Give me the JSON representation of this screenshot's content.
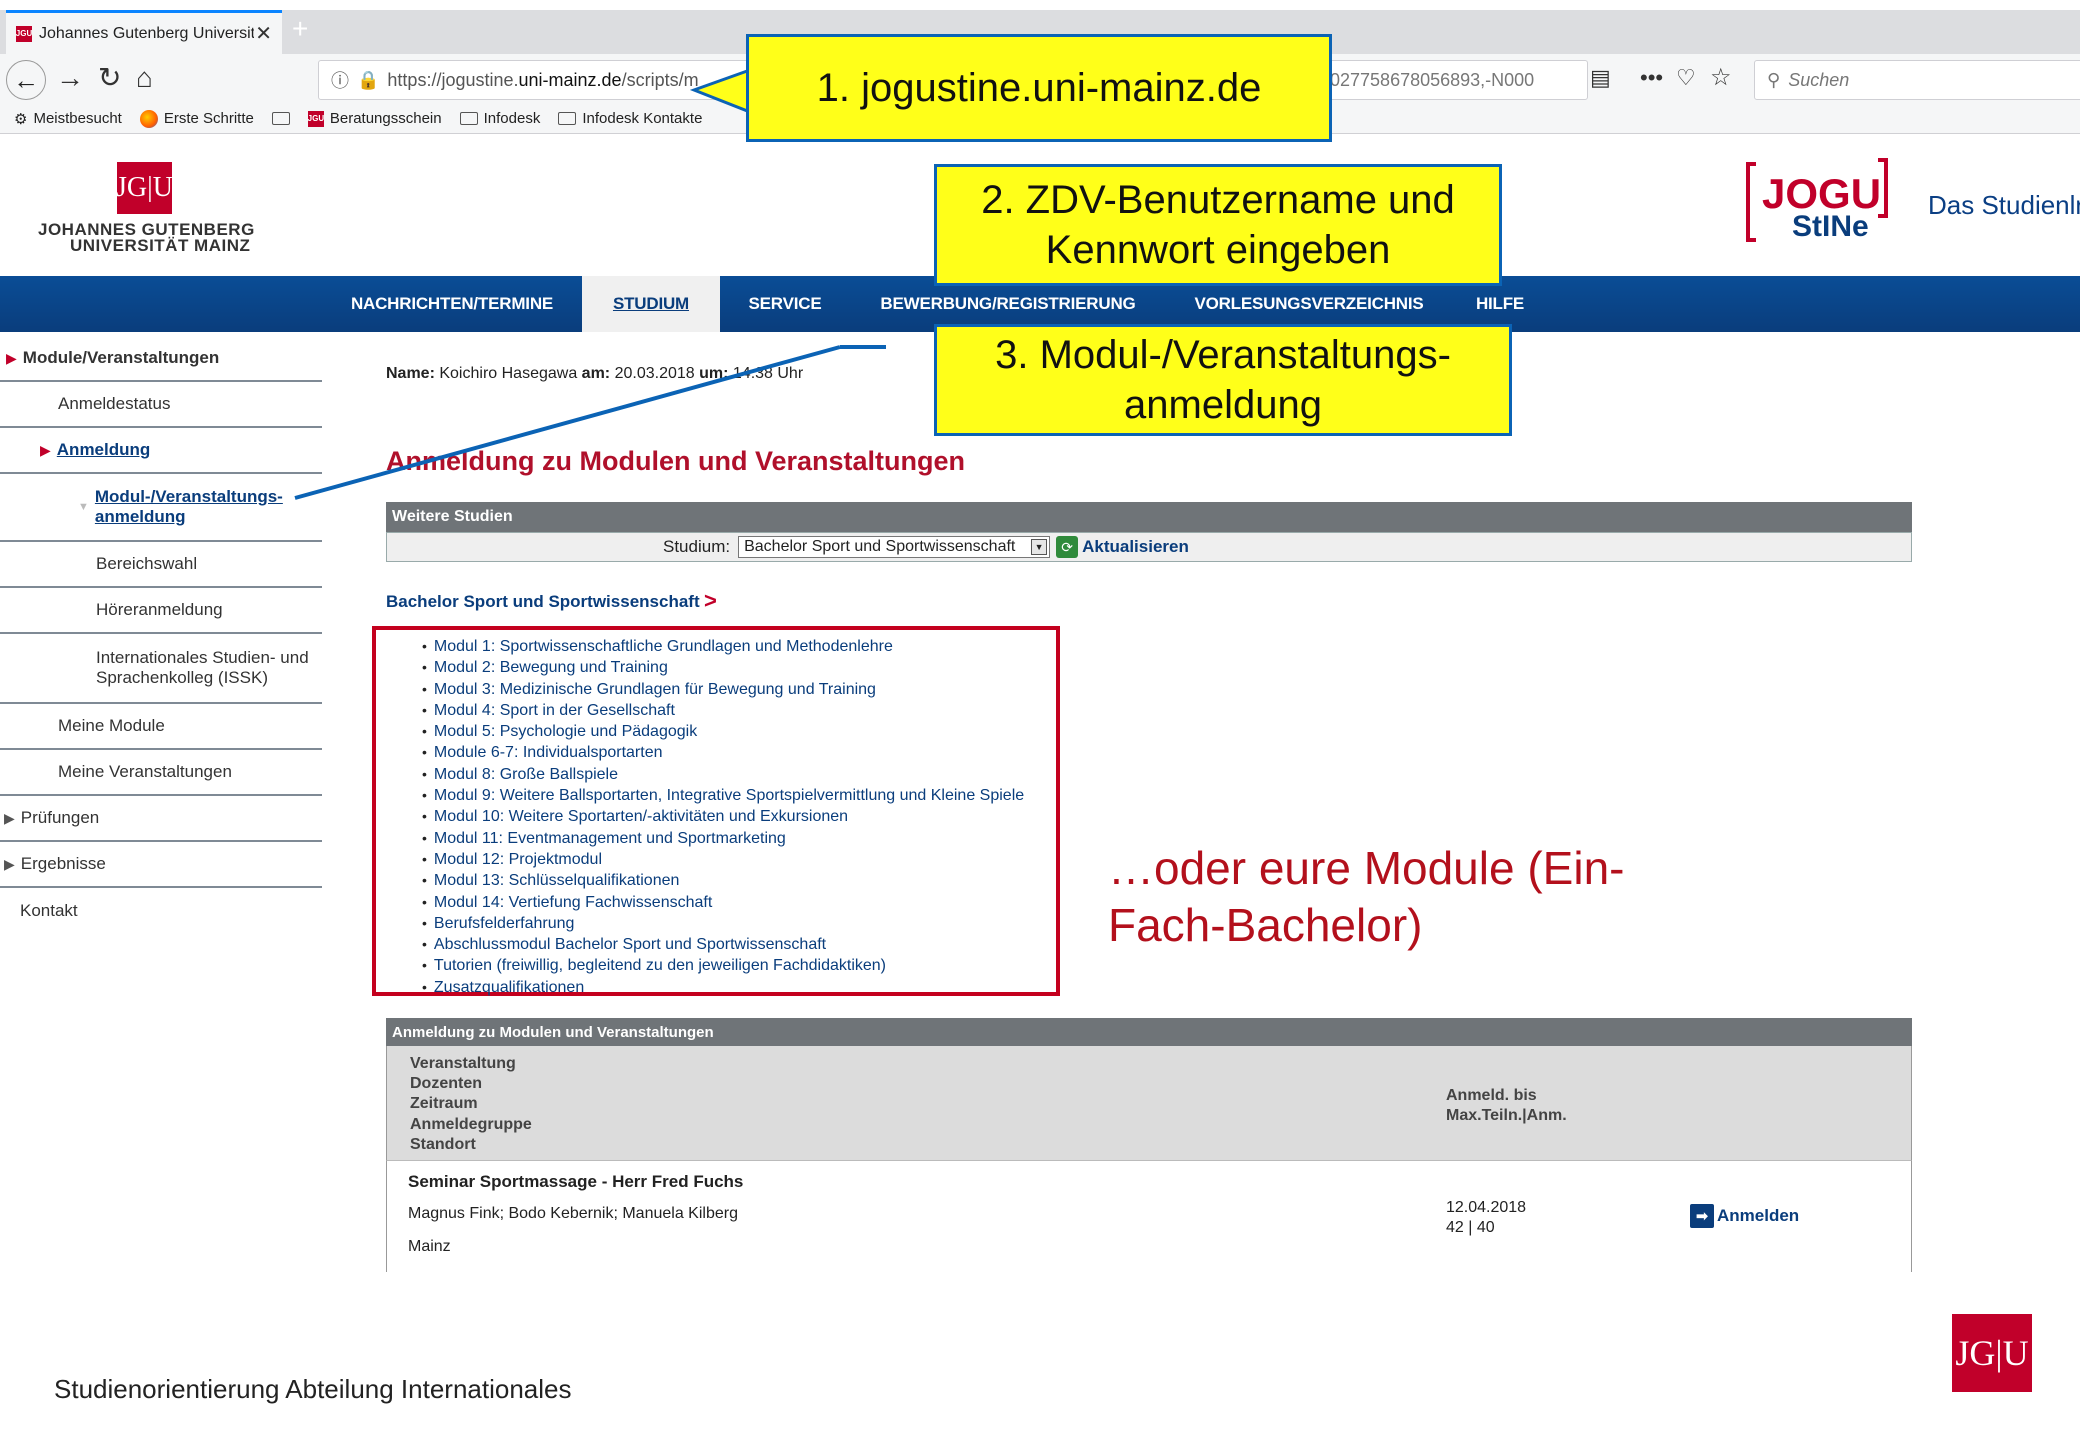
{
  "browser": {
    "tab_title": "Johannes Gutenberg Universitä",
    "tab_favicon": "JGU",
    "url_prefix": "https://jogustine.",
    "url_host": "uni-mainz.de",
    "url_path": "/scripts/m",
    "url_tail": "027758678056893,-N000",
    "search_placeholder": "Suchen",
    "bookmarks": [
      "Meistbesucht",
      "Erste Schritte",
      "Beratungsschein",
      "Infodesk",
      "Infodesk Kontakte"
    ]
  },
  "header": {
    "logo_text": "JG|U",
    "university_line1": "JOHANNES GUTENBERG",
    "university_line2": "UNIVERSITÄT MAINZ",
    "jogu_logo_top": "JOGU",
    "jogu_logo_bottom": "StINe",
    "tagline": "Das Studienlr"
  },
  "nav": {
    "items": [
      "NACHRICHTEN/TERMINE",
      "STUDIUM",
      "SERVICE",
      "BEWERBUNG/REGISTRIERUNG",
      "VORLESUNGSVERZEICHNIS",
      "HILFE"
    ]
  },
  "sidebar": {
    "items": [
      "Module/Veranstaltungen",
      "Anmeldestatus",
      "Anmeldung",
      "Modul-/Veranstaltungs-",
      "anmeldung",
      "Bereichswahl",
      "Höreranmeldung",
      "Internationales Studien- und",
      "Sprachenkolleg (ISSK)",
      "Meine Module",
      "Meine Veranstaltungen",
      "Prüfungen",
      "Ergebnisse",
      "Kontakt"
    ]
  },
  "content": {
    "name_label": "Name:",
    "name_value": "Koichiro Hasegawa",
    "date_label": "am:",
    "date_value": "20.03.2018",
    "time_label": "um:",
    "time_value": "14:38 Uhr",
    "heading": "Anmeldung zu Modulen und Veranstaltungen",
    "weitere_studien_title": "Weitere Studien",
    "studium_label": "Studium:",
    "studium_selected": "Bachelor Sport und Sportwissenschaft",
    "refresh_label": "Aktualisieren",
    "program_title": "Bachelor Sport und Sportwissenschaft",
    "program_arrow": ">",
    "modules": [
      "Modul 1: Sportwissenschaftliche Grundlagen und Methodenlehre",
      "Modul 2: Bewegung und Training",
      "Modul 3: Medizinische Grundlagen für Bewegung und Training",
      "Modul 4: Sport in der Gesellschaft",
      "Modul 5: Psychologie und Pädagogik",
      "Module 6-7: Individualsportarten",
      "Modul 8: Große Ballspiele",
      "Modul 9: Weitere Ballsportarten, Integrative Sportspielvermittlung und Kleine Spiele",
      "Modul 10: Weitere Sportarten/-aktivitäten und Exkursionen",
      "Modul 11: Eventmanagement und Sportmarketing",
      "Modul 12: Projektmodul",
      "Modul 13: Schlüsselqualifikationen",
      "Modul 14: Vertiefung Fachwissenschaft",
      "Berufsfelderfahrung",
      "Abschlussmodul Bachelor Sport und Sportwissenschaft",
      "Tutorien (freiwillig, begleitend zu den jeweiligen Fachdidaktiken)",
      "Zusatzqualifikationen"
    ],
    "registration_table_title": "Anmeldung zu Modulen und Veranstaltungen",
    "col_left": [
      "Veranstaltung",
      "Dozenten",
      "Zeitraum",
      "Anmeldegruppe",
      "Standort"
    ],
    "col_right": [
      "Anmeld. bis",
      "Max.Teiln.|Anm."
    ],
    "course": {
      "title": "Seminar Sportmassage - Herr Fred Fuchs",
      "lecturers": "Magnus Fink; Bodo Kebernik; Manuela Kilberg",
      "location": "Mainz",
      "deadline": "12.04.2018",
      "capacity": "42 | 40",
      "register_label": "Anmelden"
    }
  },
  "annotations": {
    "callout1": "1. jogustine.uni-mainz.de",
    "callout2_line1": "2. ZDV-Benutzername und",
    "callout2_line2": "Kennwort eingeben",
    "callout3_line1": "3. Modul-/Veranstaltungs-",
    "callout3_line2": "anmeldung",
    "red_note": "…oder eure Module (Ein-Fach-Bachelor)"
  },
  "footer": {
    "text": "Studienorientierung Abteilung Internationales",
    "logo_text": "JG|U"
  },
  "colors": {
    "nav_blue": "#0a3d7c",
    "jgu_red": "#c1002a",
    "callout_yellow": "#ffff19",
    "callout_border": "#0b63b5",
    "highlight_red": "#c4001e"
  }
}
